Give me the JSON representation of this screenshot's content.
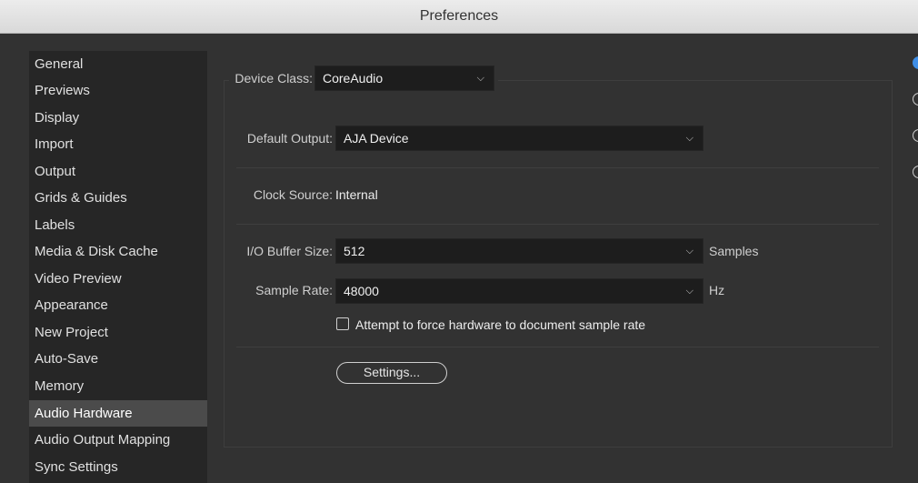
{
  "window": {
    "title": "Preferences"
  },
  "sidebar": {
    "items": [
      {
        "label": "General"
      },
      {
        "label": "Previews"
      },
      {
        "label": "Display"
      },
      {
        "label": "Import"
      },
      {
        "label": "Output"
      },
      {
        "label": "Grids & Guides"
      },
      {
        "label": "Labels"
      },
      {
        "label": "Media & Disk Cache"
      },
      {
        "label": "Video Preview"
      },
      {
        "label": "Appearance"
      },
      {
        "label": "New Project"
      },
      {
        "label": "Auto-Save"
      },
      {
        "label": "Memory"
      },
      {
        "label": "Audio Hardware",
        "selected": true
      },
      {
        "label": "Audio Output Mapping"
      },
      {
        "label": "Sync Settings"
      }
    ]
  },
  "audio_hardware": {
    "device_class": {
      "label": "Device Class:",
      "value": "CoreAudio"
    },
    "default_output": {
      "label": "Default Output:",
      "value": "AJA Device"
    },
    "clock_source": {
      "label": "Clock Source:",
      "value": "Internal"
    },
    "io_buffer_size": {
      "label": "I/O Buffer Size:",
      "value": "512",
      "unit": "Samples"
    },
    "sample_rate": {
      "label": "Sample Rate:",
      "value": "48000",
      "unit": "Hz"
    },
    "force_rate_checkbox": {
      "label": "Attempt to force hardware to document sample rate",
      "checked": false
    },
    "settings_button": {
      "label": "Settings..."
    }
  },
  "icons": {
    "chevron": "chevron-down-icon"
  },
  "colors": {
    "background": "#323232",
    "sidebar": "#262626",
    "selected": "#4b4b4b",
    "accent": "#3f8ee6"
  }
}
